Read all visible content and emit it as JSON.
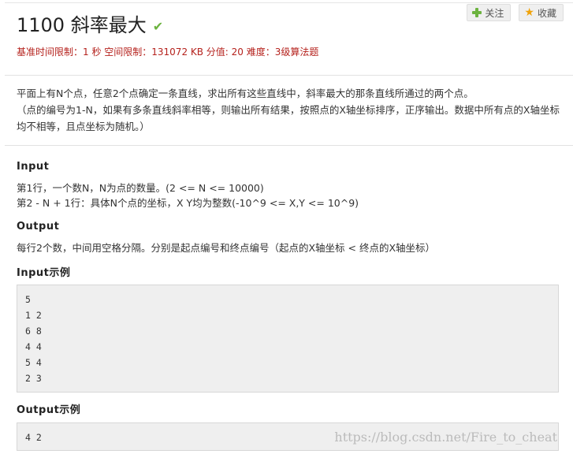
{
  "problem": {
    "title": "1100 斜率最大",
    "meta": "基准时间限制：1 秒 空间限制：131072 KB 分值: 20 难度：3级算法题",
    "follow_label": "关注",
    "collect_label": "收藏"
  },
  "description": {
    "line1": "平面上有N个点，任意2个点确定一条直线，求出所有这些直线中，斜率最大的那条直线所通过的两个点。",
    "line2": "（点的编号为1-N，如果有多条直线斜率相等，则输出所有结果，按照点的X轴坐标排序，正序输出。数据中所有点的X轴坐标均不相等，且点坐标为随机。）"
  },
  "input": {
    "heading": "Input",
    "line1": "第1行，一个数N，N为点的数量。(2 <= N <= 10000)",
    "line2": "第2 - N + 1行：具体N个点的坐标，X Y均为整数(-10^9 <= X,Y <= 10^9)"
  },
  "output": {
    "heading": "Output",
    "line1": "每行2个数，中间用空格分隔。分别是起点编号和终点编号（起点的X轴坐标 < 终点的X轴坐标）"
  },
  "input_sample": {
    "heading": "Input示例",
    "lines": [
      "5",
      "1 2",
      "6 8",
      "4 4",
      "5 4",
      "2 3"
    ]
  },
  "output_sample": {
    "heading": "Output示例",
    "lines": [
      "4 2"
    ]
  },
  "watermark": "https://blog.csdn.net/Fire_to_cheat"
}
